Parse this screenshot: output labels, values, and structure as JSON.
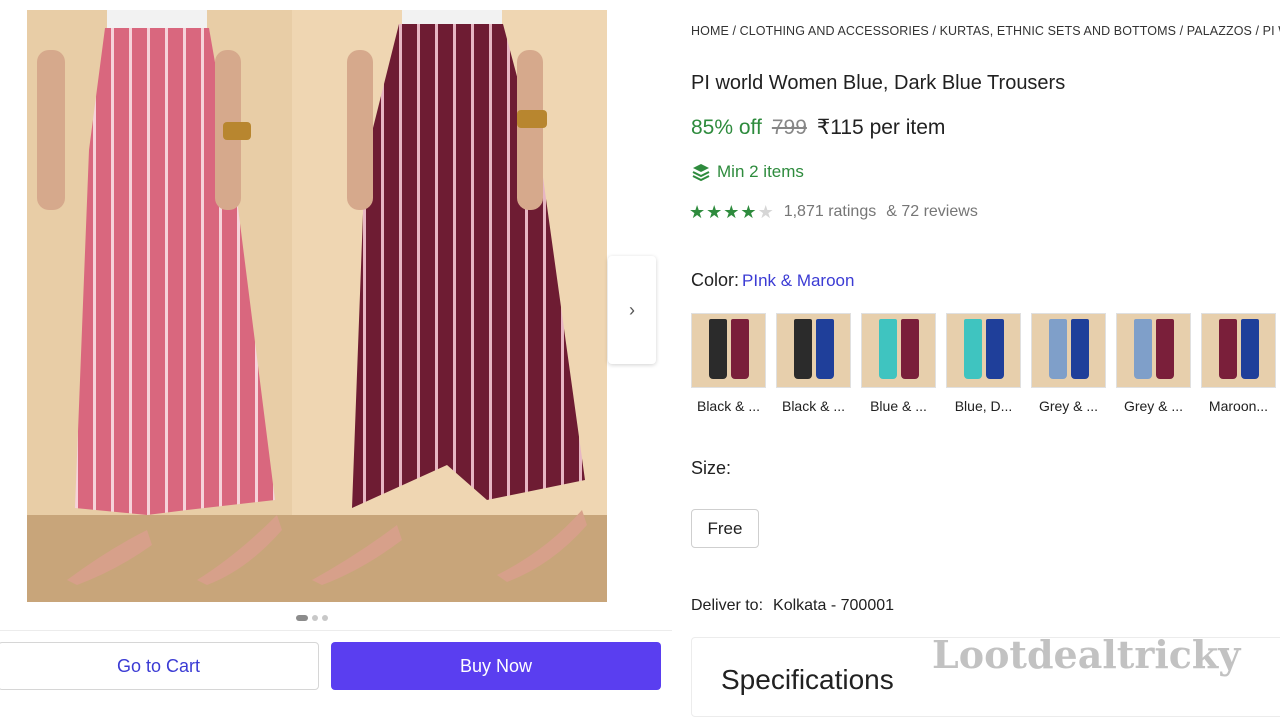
{
  "breadcrumb": [
    "HOME",
    "CLOTHING AND ACCESSORIES",
    "KURTAS, ETHNIC SETS AND BOTTOMS",
    "PALAZZOS",
    "PI WO"
  ],
  "product": {
    "title": "PI world Women Blue, Dark Blue Trousers",
    "discount": "85% off",
    "mrp": "799",
    "price": "₹115 per item",
    "min_items": "Min 2 items",
    "rating_stars": 4,
    "ratings_text": "1,871 ratings",
    "reviews_text": "& 72 reviews"
  },
  "color": {
    "label": "Color:",
    "selected": "PInk & Maroon",
    "options": [
      {
        "label": "Black & ...",
        "left": "#2b2b2b",
        "right": "#7a1f3a"
      },
      {
        "label": "Black & ...",
        "left": "#2b2b2b",
        "right": "#1f3f9a"
      },
      {
        "label": "Blue & ...",
        "left": "#3fc4c0",
        "right": "#7a1f3a"
      },
      {
        "label": "Blue, D...",
        "left": "#3fc4c0",
        "right": "#1f3f9a"
      },
      {
        "label": "Grey & ...",
        "left": "#7f9fc9",
        "right": "#1f3f9a"
      },
      {
        "label": "Grey & ...",
        "left": "#7f9fc9",
        "right": "#7a1f3a"
      },
      {
        "label": "Maroon...",
        "left": "#7a1f3a",
        "right": "#1f3f9a"
      }
    ]
  },
  "size": {
    "label": "Size:",
    "options": [
      "Free"
    ]
  },
  "delivery": {
    "label": "Deliver to:",
    "location": "Kolkata - 700001"
  },
  "specifications": {
    "title": "Specifications"
  },
  "buttons": {
    "cart": "Go to Cart",
    "buy": "Buy Now"
  },
  "watermark": "Lootdealtricky",
  "colors": {
    "accent": "#5a3ef0",
    "link": "#3b3bd4",
    "green": "#2e8b3d",
    "pink": "#d9677e",
    "maroon": "#6e1c33"
  }
}
